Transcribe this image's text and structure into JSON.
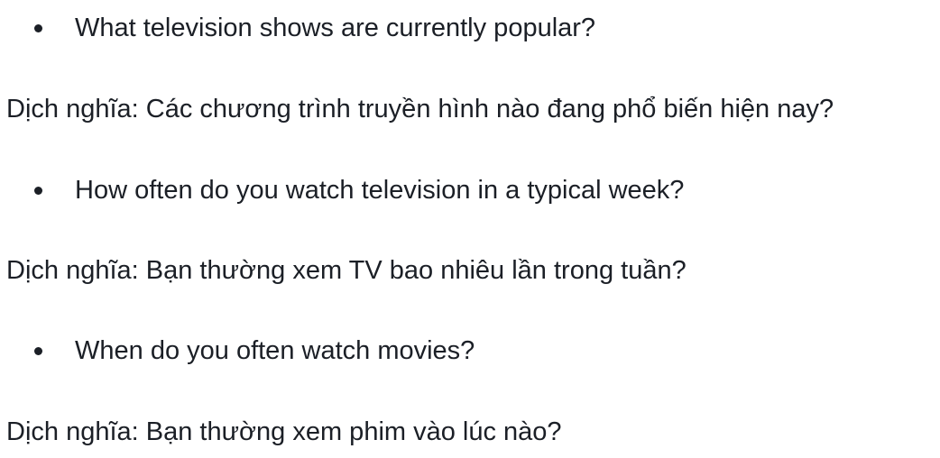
{
  "items": [
    {
      "question": "What television shows are currently popular?",
      "translation": "Dịch nghĩa: Các chương trình truyền hình nào đang phổ biến hiện nay?"
    },
    {
      "question": "How often do you watch television in a typical week?",
      "translation": "Dịch nghĩa: Bạn thường xem TV bao nhiêu lần trong tuần?"
    },
    {
      "question": "When do you often watch movies?",
      "translation": "Dịch nghĩa: Bạn thường xem phim vào lúc nào?"
    }
  ]
}
